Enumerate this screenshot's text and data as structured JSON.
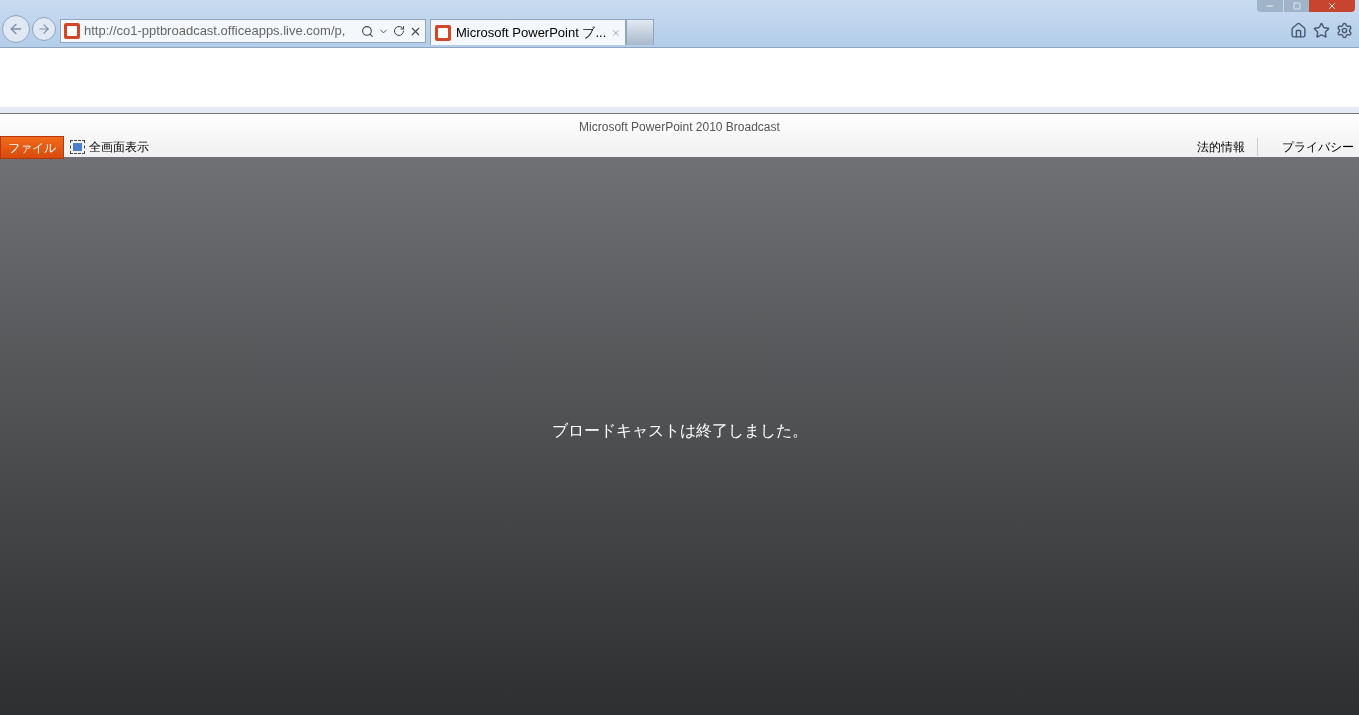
{
  "browser": {
    "address": "http://co1-pptbroadcast.officeapps.live.com/p,",
    "tabs": [
      {
        "title": "Microsoft PowerPoint ブ...",
        "selected": true
      }
    ]
  },
  "app": {
    "title": "Microsoft PowerPoint 2010 Broadcast",
    "file_tab": "ファイル",
    "fullscreen": "全画面表示",
    "links": [
      "法的情報",
      "プライバシー"
    ]
  },
  "message": "ブロードキャストは終了しました。"
}
